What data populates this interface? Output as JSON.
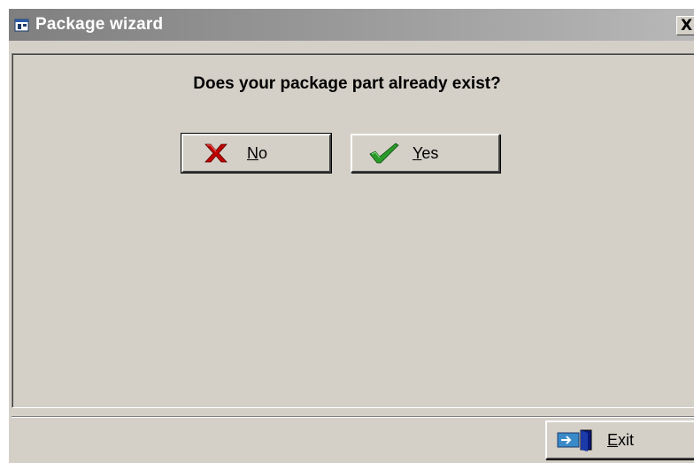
{
  "window": {
    "title": "Package wizard",
    "icon": "package-wizard-icon",
    "close_label": "X"
  },
  "main": {
    "question": "Does your package part already exist?",
    "no_button": {
      "mnemonic": "N",
      "rest": "o",
      "icon": "red-x-icon"
    },
    "yes_button": {
      "mnemonic": "Y",
      "rest": "es",
      "icon": "green-check-icon"
    }
  },
  "footer": {
    "exit_button": {
      "mnemonic": "E",
      "rest": "xit",
      "icon": "exit-door-icon"
    }
  },
  "colors": {
    "face": "#d4d0c8",
    "title_gradient_start": "#7f7f7f",
    "no_icon": "#c00000",
    "yes_icon": "#2a9a2a"
  }
}
